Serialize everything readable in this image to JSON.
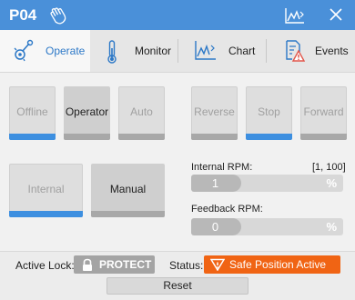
{
  "titlebar": {
    "title": "P04"
  },
  "tabs": [
    {
      "label": "Operate",
      "active": true
    },
    {
      "label": "Monitor",
      "active": false
    },
    {
      "label": "Chart",
      "active": false
    },
    {
      "label": "Events",
      "active": false
    }
  ],
  "mode_buttons": [
    {
      "label": "Offline",
      "indicator": "on"
    },
    {
      "label": "Operator",
      "indicator": "off"
    },
    {
      "label": "Auto",
      "indicator": "off"
    }
  ],
  "direction_buttons": [
    {
      "label": "Reverse",
      "indicator": "off"
    },
    {
      "label": "Stop",
      "indicator": "on"
    },
    {
      "label": "Forward",
      "indicator": "off"
    }
  ],
  "source_buttons": [
    {
      "label": "Internal",
      "indicator": "on"
    },
    {
      "label": "Manual",
      "indicator": "off"
    }
  ],
  "internal_rpm": {
    "label": "Internal RPM:",
    "range": "[1, 100]",
    "value": "1",
    "unit": "%",
    "fill_fraction": 0.33
  },
  "feedback_rpm": {
    "label": "Feedback RPM:",
    "value": "0",
    "unit": "%",
    "fill_fraction": 0.33
  },
  "footer": {
    "active_lock_label": "Active Lock:",
    "lock_value": "PROTECT",
    "status_label": "Status:",
    "status_value": "Safe Position Active",
    "reset_label": "Reset"
  },
  "colors": {
    "accent": "#4a90d9",
    "indicator_on": "#3d8fe0",
    "status": "#f06414"
  }
}
